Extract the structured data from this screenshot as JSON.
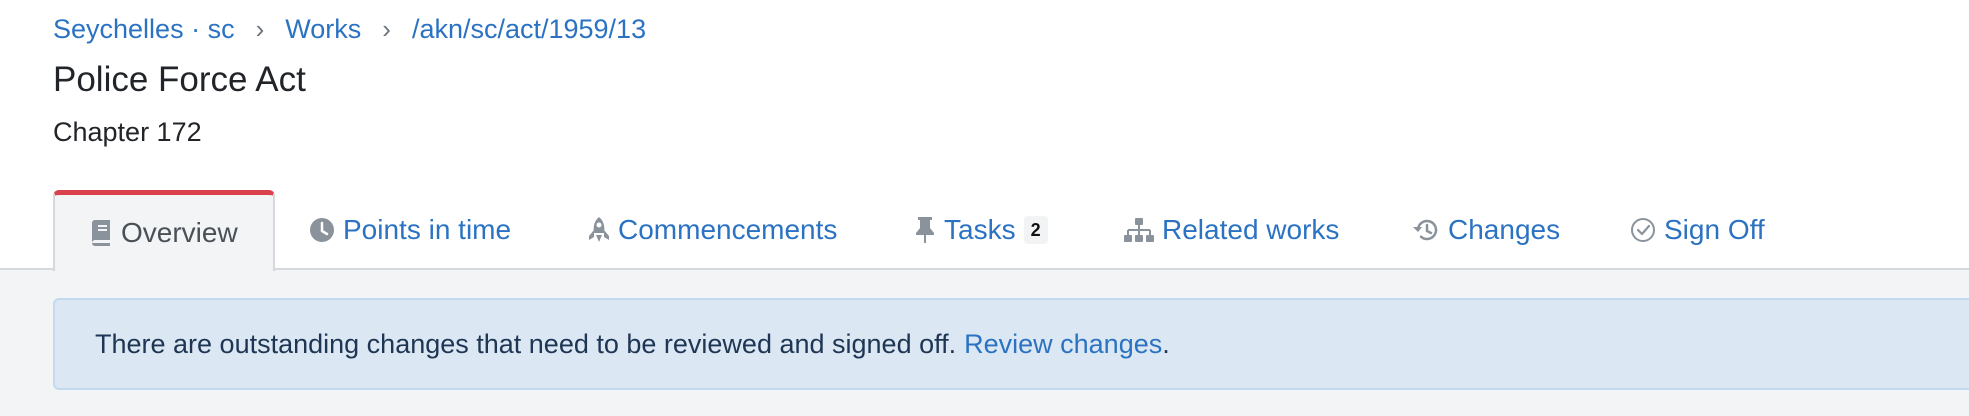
{
  "breadcrumb": {
    "items": [
      "Seychelles · sc",
      "Works",
      "/akn/sc/act/1959/13"
    ],
    "separator": "›"
  },
  "page": {
    "title": "Police Force Act",
    "subtitle": "Chapter 172"
  },
  "tabs": [
    {
      "label": "Overview",
      "icon": "book-icon",
      "active": true
    },
    {
      "label": "Points in time",
      "icon": "clock-icon"
    },
    {
      "label": "Commencements",
      "icon": "rocket-icon"
    },
    {
      "label": "Tasks",
      "icon": "pin-icon",
      "badge": "2"
    },
    {
      "label": "Related works",
      "icon": "sitemap-icon"
    },
    {
      "label": "Changes",
      "icon": "history-icon"
    },
    {
      "label": "Sign Off",
      "icon": "check-circle-icon"
    }
  ],
  "alert": {
    "text": "There are outstanding changes that need to be reviewed and signed off.",
    "link_label": "Review changes",
    "suffix": "."
  },
  "colors": {
    "link": "#2b73c2",
    "active_tab_accent": "#d9414d",
    "alert_background": "#dbe7f3",
    "content_background": "#f3f4f6"
  }
}
